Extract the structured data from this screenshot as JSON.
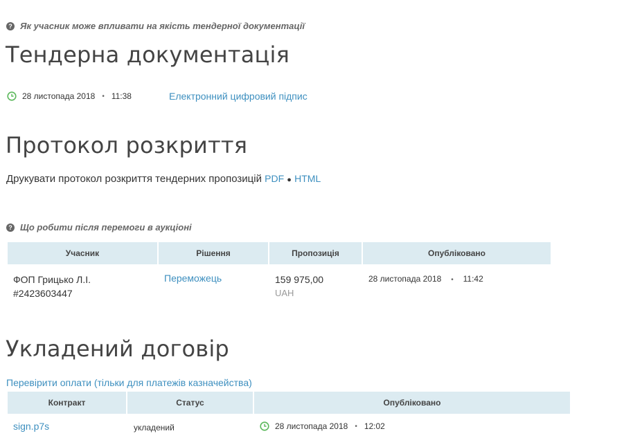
{
  "help_quality": "Як учасник може впливати на якість тендерної документації",
  "tender_docs": {
    "title": "Тендерна документація",
    "date": "28 листопада 2018",
    "time": "11:38",
    "signature_link": "Електронний цифровий підпис"
  },
  "protocol": {
    "title": "Протокол розкриття",
    "print_text": "Друкувати протокол розкриття тендерних пропозицій",
    "pdf_link": "PDF",
    "bullet": "●",
    "html_link": "HTML"
  },
  "help_after_win": "Що робити після перемоги в аукціоні",
  "bids_table": {
    "headers": [
      "Учасник",
      "Рішення",
      "Пропозиція",
      "Опубліковано"
    ],
    "rows": [
      {
        "participant_name": "ФОП Грицько Л.І.",
        "participant_id": "#2423603447",
        "decision": "Переможець",
        "amount": "159 975,00",
        "currency": "UAH",
        "date": "28 листопада 2018",
        "time": "11:42"
      }
    ]
  },
  "contract": {
    "title": "Укладений договір",
    "check_payments_link": "Перевірити оплати (тільки для платежів казначейства)",
    "headers": [
      "Контракт",
      "Статус",
      "Опубліковано"
    ],
    "rows": [
      {
        "file": "sign.p7s",
        "status": "укладений",
        "date": "28 листопада 2018",
        "time": "12:02"
      }
    ]
  },
  "colors": {
    "link": "#3d8fbf",
    "header_bg": "#dcebf1",
    "clock_green": "#5cb85c"
  }
}
